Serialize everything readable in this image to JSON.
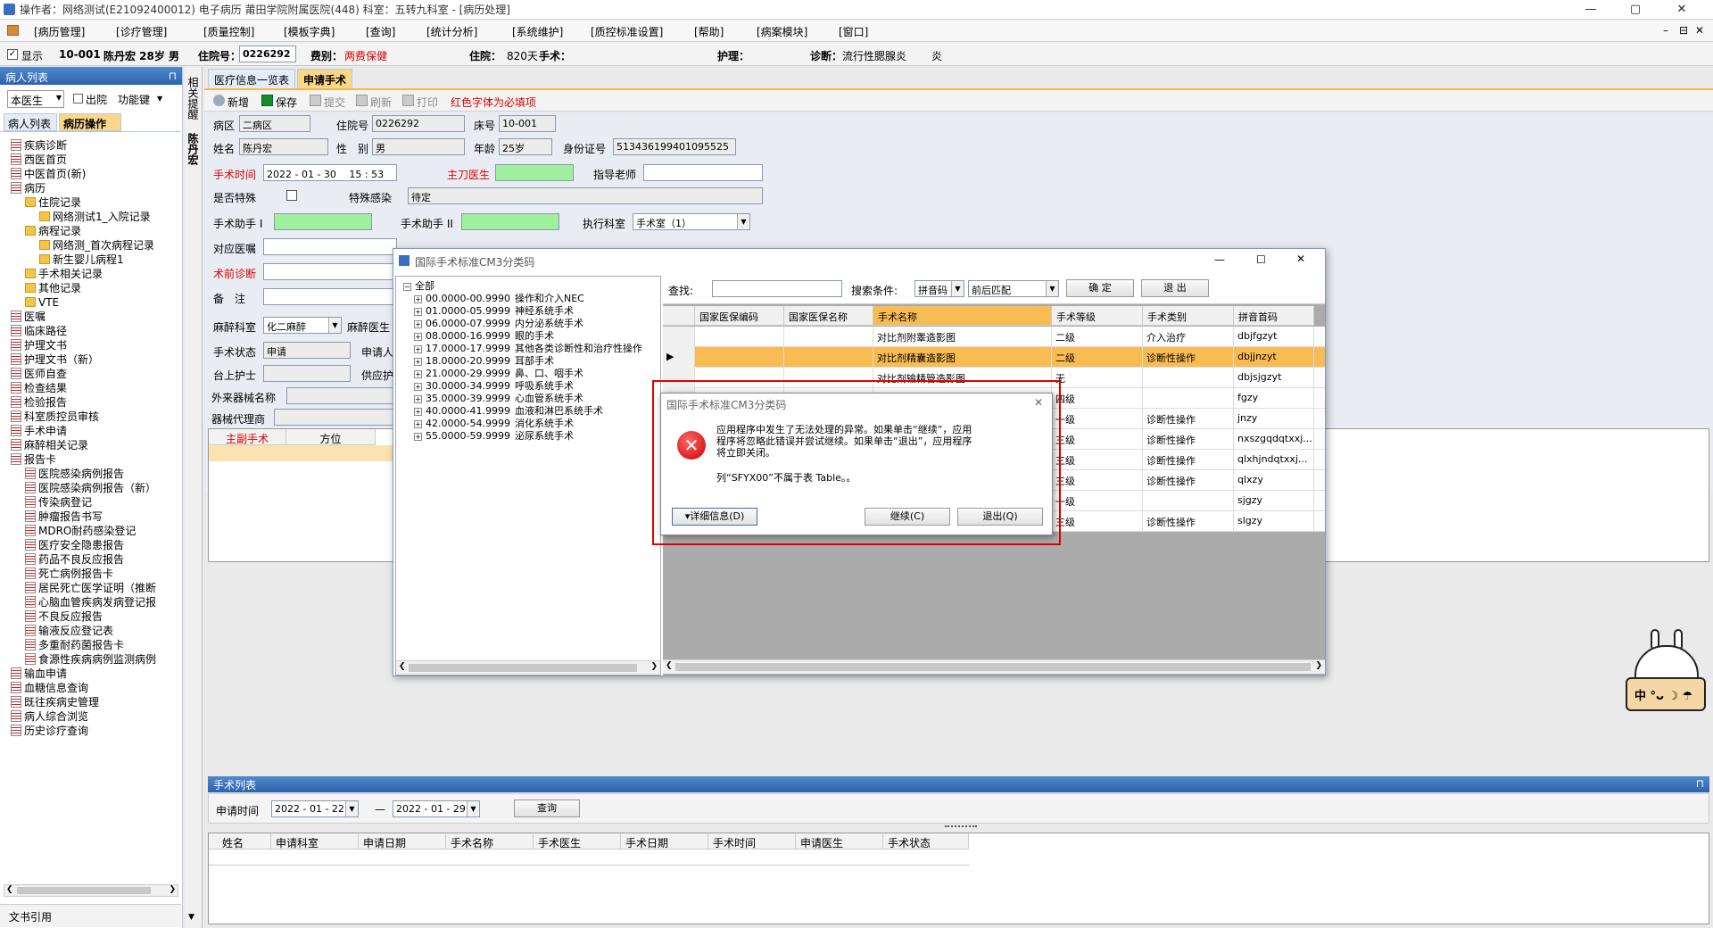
{
  "title": "操作者：网络测试(E21092400012) 电子病历  莆田学院附属医院(448)  科室：五转九科室 - [病历处理]",
  "window_buttons": [
    "—",
    "▢",
    "✕"
  ],
  "menu": [
    "[病历管理]",
    "[诊疗管理]",
    "[质量控制]",
    "[模板字典]",
    "[查询]",
    "[统计分析]",
    "[系统维护]",
    "[质控标准设置]",
    "[帮助]",
    "[病案模块]",
    "[窗口]"
  ],
  "menu_controls": [
    "–",
    "⊟",
    "✕"
  ],
  "patient": {
    "show_label": "显示",
    "bed": "10-001",
    "name_age": "陈丹宏 28岁 男",
    "admission_label": "住院号：",
    "admission_no": "0226292",
    "fee_label": "费别：",
    "fee_value": "两费保健",
    "stay_label": "住院：",
    "stay_value": "820天",
    "surgery_label": "手术：",
    "care_label": "护理：",
    "diag_label": "诊断：",
    "diag_value": "流行性腮腺炎",
    "extra": "炎"
  },
  "left": {
    "header": "病人列表",
    "pin": "⊓",
    "doctor": "本医生",
    "discharge": "出院",
    "func_key": "功能键",
    "tabs": [
      "病人列表",
      "病历操作"
    ],
    "tree": [
      {
        "label": "疾病诊断",
        "lvl": 1,
        "ico": "doc"
      },
      {
        "label": "西医首页",
        "lvl": 1,
        "ico": "doc"
      },
      {
        "label": "中医首页(新)",
        "lvl": 1,
        "ico": "doc"
      },
      {
        "label": "病历",
        "lvl": 1,
        "ico": "doc"
      },
      {
        "label": "住院记录",
        "lvl": 2,
        "ico": "fold"
      },
      {
        "label": "网络测试1_入院记录",
        "lvl": 3,
        "ico": "fold"
      },
      {
        "label": "病程记录",
        "lvl": 2,
        "ico": "fold"
      },
      {
        "label": "网络测_首次病程记录",
        "lvl": 3,
        "ico": "fold"
      },
      {
        "label": "新生婴儿病程1",
        "lvl": 3,
        "ico": "fold"
      },
      {
        "label": "手术相关记录",
        "lvl": 2,
        "ico": "fold"
      },
      {
        "label": "其他记录",
        "lvl": 2,
        "ico": "fold"
      },
      {
        "label": "VTE",
        "lvl": 2,
        "ico": "fold"
      },
      {
        "label": "医嘱",
        "lvl": 1,
        "ico": "doc"
      },
      {
        "label": "临床路径",
        "lvl": 1,
        "ico": "doc"
      },
      {
        "label": "护理文书",
        "lvl": 1,
        "ico": "doc"
      },
      {
        "label": "护理文书（新）",
        "lvl": 1,
        "ico": "doc"
      },
      {
        "label": "医师自查",
        "lvl": 1,
        "ico": "doc"
      },
      {
        "label": "检查结果",
        "lvl": 1,
        "ico": "doc"
      },
      {
        "label": "检验报告",
        "lvl": 1,
        "ico": "doc"
      },
      {
        "label": "科室质控员审核",
        "lvl": 1,
        "ico": "doc"
      },
      {
        "label": "手术申请",
        "lvl": 1,
        "ico": "doc"
      },
      {
        "label": "麻醉相关记录",
        "lvl": 1,
        "ico": "doc"
      },
      {
        "label": "报告卡",
        "lvl": 1,
        "ico": "doc"
      },
      {
        "label": "医院感染病例报告",
        "lvl": 2,
        "ico": "doc"
      },
      {
        "label": "医院感染病例报告（新）",
        "lvl": 2,
        "ico": "doc"
      },
      {
        "label": "传染病登记",
        "lvl": 2,
        "ico": "doc"
      },
      {
        "label": "肿瘤报告书写",
        "lvl": 2,
        "ico": "doc"
      },
      {
        "label": "MDRO耐药感染登记",
        "lvl": 2,
        "ico": "doc"
      },
      {
        "label": "医疗安全隐患报告",
        "lvl": 2,
        "ico": "doc"
      },
      {
        "label": "药品不良反应报告",
        "lvl": 2,
        "ico": "doc"
      },
      {
        "label": "死亡病例报告卡",
        "lvl": 2,
        "ico": "doc"
      },
      {
        "label": "居民死亡医学证明（推断",
        "lvl": 2,
        "ico": "doc"
      },
      {
        "label": "心脑血管疾病发病登记报",
        "lvl": 2,
        "ico": "doc"
      },
      {
        "label": "不良反应报告",
        "lvl": 2,
        "ico": "doc"
      },
      {
        "label": "输液反应登记表",
        "lvl": 2,
        "ico": "doc"
      },
      {
        "label": "多重耐药菌报告卡",
        "lvl": 2,
        "ico": "doc"
      },
      {
        "label": "食源性疾病病例监测病例",
        "lvl": 2,
        "ico": "doc"
      },
      {
        "label": "输血申请",
        "lvl": 1,
        "ico": "doc"
      },
      {
        "label": "血糖信息查询",
        "lvl": 1,
        "ico": "doc"
      },
      {
        "label": "既往疾病史管理",
        "lvl": 1,
        "ico": "doc"
      },
      {
        "label": "病人综合浏览",
        "lvl": 1,
        "ico": "doc"
      },
      {
        "label": "历史诊疗查询",
        "lvl": 1,
        "ico": "doc"
      }
    ],
    "footer": "文书引用"
  },
  "vtabs": [
    "相关提醒",
    "陈丹宏"
  ],
  "tabs": [
    "医疗信息一览表",
    "申请手术"
  ],
  "toolbar": {
    "new": "新增",
    "save": "保存",
    "submit": "提交",
    "refresh": "刷新",
    "print": "打印",
    "hint": "红色字体为必填项"
  },
  "form": {
    "ward_label": "病区",
    "ward": "二病区",
    "admit_label": "住院号",
    "admit": "0226292",
    "bed_label": "床号",
    "bed": "10-001",
    "name_label": "姓名",
    "name": "陈丹宏",
    "sex_label": "性　别",
    "sex": "男",
    "age_label": "年龄",
    "age": "25岁",
    "id_label": "身份证号",
    "id": "513436199401095525",
    "time_label": "手术时间",
    "time": "2022 - 01 - 30　 15 : 53",
    "surgeon_label": "主刀医生",
    "mentor_label": "指导老师",
    "special_label": "是否特殊",
    "infect_label": "特殊感染",
    "infect": "待定",
    "asst1_label": "手术助手 I",
    "asst2_label": "手术助手 II",
    "dept_label": "执行科室",
    "dept": "手术室（1）",
    "order_label": "对应医嘱",
    "prediag_label": "术前诊断",
    "note_label": "备　注",
    "anes_dept_label": "麻醉科室",
    "anes_dept": "化二麻醉",
    "anes_doc_label": "麻醉医生",
    "status_label": "手术状态",
    "status": "申请",
    "applicant_label": "申请人",
    "nurse_label": "台上护士",
    "supply_label": "供应护",
    "device_label": "外来器械名称",
    "agent_label": "器械代理商"
  },
  "sub_grid": [
    "主副手术",
    "方位"
  ],
  "cm3": {
    "title": "国际手术标准CM3分类码",
    "tree_root": "全部",
    "tree": [
      {
        "code": "00.0000-00.9990",
        "name": "操作和介入NEC"
      },
      {
        "code": "01.0000-05.9999",
        "name": "神经系统手术"
      },
      {
        "code": "06.0000-07.9999",
        "name": "内分泌系统手术"
      },
      {
        "code": "08.0000-16.9999",
        "name": "眼的手术"
      },
      {
        "code": "17.0000-17.9999",
        "name": "其他各类诊断性和治疗性操作"
      },
      {
        "code": "18.0000-20.9999",
        "name": "耳部手术"
      },
      {
        "code": "21.0000-29.9999",
        "name": "鼻、口、咽手术"
      },
      {
        "code": "30.0000-34.9999",
        "name": "呼吸系统手术"
      },
      {
        "code": "35.0000-39.9999",
        "name": "心血管系统手术"
      },
      {
        "code": "40.0000-41.9999",
        "name": "血液和淋巴系统手术"
      },
      {
        "code": "42.0000-54.9999",
        "name": "消化系统手术"
      },
      {
        "code": "55.0000-59.9999",
        "name": "泌尿系统手术"
      }
    ],
    "search_label": "查找:",
    "cond_label": "搜索条件:",
    "cond1": "拼音码",
    "cond2": "前后匹配",
    "ok": "确 定",
    "exit": "退 出",
    "columns": [
      "国家医保编码",
      "国家医保名称",
      "手术名称",
      "手术等级",
      "手术类别",
      "拼音首码"
    ],
    "rows": [
      {
        "name": "对比剂附睾造影图",
        "level": "二级",
        "type": "介入治疗",
        "py": "dbjfgzyt"
      },
      {
        "name": "对比剂精囊造影图",
        "level": "二级",
        "type": "诊断性操作",
        "py": "dbjjnzyt"
      },
      {
        "name": "对比剂输精管造影图",
        "level": "无",
        "type": "",
        "py": "dbjsjgzyt"
      },
      {
        "name": "附睾造影",
        "level": "四级",
        "type": "",
        "py": "fgzy"
      },
      {
        "name": "",
        "level": "一级",
        "type": "诊断性操作",
        "py": "jnzy"
      },
      {
        "name": "",
        "level": "三级",
        "type": "诊断性操作",
        "py": "nxszgqdqtxxj..."
      },
      {
        "name": "",
        "level": "三级",
        "type": "诊断性操作",
        "py": "qlxhjndqtxxj..."
      },
      {
        "name": "",
        "level": "三级",
        "type": "诊断性操作",
        "py": "qlxzy"
      },
      {
        "name": "",
        "level": "一级",
        "type": "",
        "py": "sjgzy"
      },
      {
        "name": "",
        "level": "三级",
        "type": "诊断性操作",
        "py": "slgzy"
      }
    ],
    "win_controls": [
      "—",
      "☐",
      "✕"
    ]
  },
  "error": {
    "title": "国际手术标准CM3分类码",
    "message": "应用程序中发生了无法处理的异常。如果单击“继续”，应用程序将忽略此错误并尝试继续。如果单击“退出”，应用程序将立即关闭。",
    "detail_msg": "列“SFYX00”不属于表 Table。。",
    "detail_btn": "▾详细信息(D)",
    "continue_btn": "继续(C)",
    "quit_btn": "退出(Q)",
    "close": "✕"
  },
  "list": {
    "header": "手术列表",
    "date_label": "申请时间",
    "date_from": "2022 - 01 - 22",
    "dash": "—",
    "date_to": "2022 - 01 - 29",
    "query": "查询",
    "columns": [
      "姓名",
      "申请科室",
      "申请日期",
      "手术名称",
      "手术医生",
      "手术日期",
      "手术时间",
      "申请医生",
      "手术状态"
    ]
  },
  "mascot_text": "中 °ᴗ ☽ ☂",
  "colors": {
    "panel_head": "#3a72bd",
    "required": "#e00000",
    "selected_row": "#f8bc52",
    "green_field": "#9ef09e"
  }
}
